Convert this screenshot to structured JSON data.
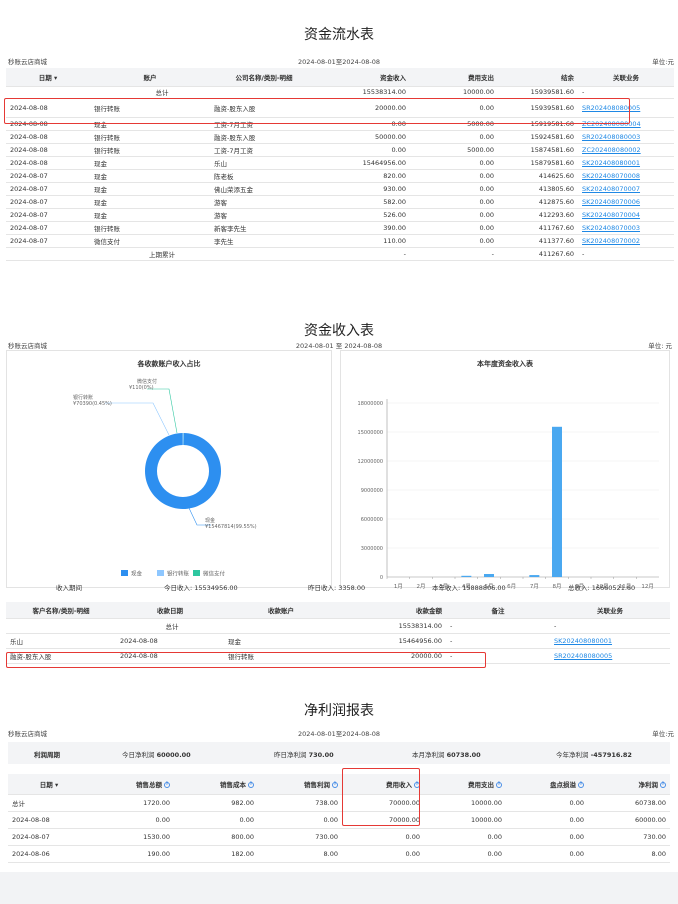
{
  "cash_flow": {
    "title": "资金流水表",
    "store": "秒账云店商城",
    "range": "2024-08-01至2024-08-08",
    "unit": "单位:元",
    "headers": [
      "日期 ▾",
      "账户",
      "公司名称/类别-明细",
      "资金收入",
      "费用支出",
      "结余",
      "关联业务"
    ],
    "total": {
      "label": "总计",
      "income": "15538314.00",
      "expense": "10000.00",
      "balance": "15939581.60",
      "biz": "-"
    },
    "rows": [
      [
        "2024-08-08",
        "银行转账",
        "融资-股东入股",
        "20000.00",
        "0.00",
        "15939581.60",
        "SR202408080005"
      ],
      [
        "2024-08-08",
        "现金",
        "工资-7月工资",
        "0.00",
        "5000.00",
        "15919581.60",
        "ZC202408080004"
      ],
      [
        "2024-08-08",
        "银行转账",
        "融资-股东入股",
        "50000.00",
        "0.00",
        "15924581.60",
        "SR202408080003"
      ],
      [
        "2024-08-08",
        "银行转账",
        "工资-7月工资",
        "0.00",
        "5000.00",
        "15874581.60",
        "ZC202408080002"
      ],
      [
        "2024-08-08",
        "现金",
        "乐山",
        "15464956.00",
        "0.00",
        "15879581.60",
        "SK202408080001"
      ],
      [
        "2024-08-07",
        "现金",
        "陈老板",
        "820.00",
        "0.00",
        "414625.60",
        "SK202408070008"
      ],
      [
        "2024-08-07",
        "现金",
        "佛山荣添五金",
        "930.00",
        "0.00",
        "413805.60",
        "SK202408070007"
      ],
      [
        "2024-08-07",
        "现金",
        "游客",
        "582.00",
        "0.00",
        "412875.60",
        "SK202408070006"
      ],
      [
        "2024-08-07",
        "现金",
        "游客",
        "526.00",
        "0.00",
        "412293.60",
        "SK202408070004"
      ],
      [
        "2024-08-07",
        "银行转账",
        "新客李先生",
        "390.00",
        "0.00",
        "411767.60",
        "SK202408070003"
      ],
      [
        "2024-08-07",
        "微信支付",
        "李先生",
        "110.00",
        "0.00",
        "411377.60",
        "SK202408070002"
      ]
    ],
    "prev": {
      "label": "上期累计",
      "income": "-",
      "expense": "-",
      "balance": "411267.60",
      "biz": "-"
    }
  },
  "income": {
    "title": "资金收入表",
    "store": "秒账云店商城",
    "range": "2024-08-01 至 2024-08-08",
    "unit": "单位: 元",
    "pie_title": "各收款账户收入占比",
    "bar_title": "本年度资金收入表",
    "summary": {
      "label": "收入期间",
      "today": "今日收入: 15534956.00",
      "yesterday": "昨日收入: 3358.00",
      "year": "本年收入: 15888806.00",
      "total": "总收入: 16660521.60"
    },
    "headers": [
      "客户名称/类别-明细",
      "收款日期",
      "收款账户",
      "收款金额",
      "备注",
      "关联业务"
    ],
    "total": {
      "label": "总计",
      "amount": "15538314.00",
      "note": "-",
      "biz": "-"
    },
    "rows": [
      [
        "乐山",
        "2024-08-08",
        "现金",
        "15464956.00",
        "-",
        "SK202408080001"
      ],
      [
        "融资-股东入股",
        "2024-08-08",
        "银行转账",
        "20000.00",
        "-",
        "SR202408080005"
      ]
    ]
  },
  "profit": {
    "title": "净利润报表",
    "store": "秒账云店商城",
    "range": "2024-08-01至2024-08-08",
    "unit": "单位:元",
    "band": {
      "label": "利润周期",
      "today_label": "今日净利润",
      "today": "60000.00",
      "yesterday_label": "昨日净利润",
      "yesterday": "730.00",
      "month_label": "本月净利润",
      "month": "60738.00",
      "year_label": "今年净利润",
      "year": "-457916.82"
    },
    "headers": [
      "日期 ▾",
      "销售总额",
      "销售成本",
      "销售利润",
      "费用收入",
      "费用支出",
      "盘点损溢",
      "净利润"
    ],
    "rows": [
      [
        "总计",
        "1720.00",
        "982.00",
        "738.00",
        "70000.00",
        "10000.00",
        "0.00",
        "60738.00"
      ],
      [
        "2024-08-08",
        "0.00",
        "0.00",
        "0.00",
        "70000.00",
        "10000.00",
        "0.00",
        "60000.00"
      ],
      [
        "2024-08-07",
        "1530.00",
        "800.00",
        "730.00",
        "0.00",
        "0.00",
        "0.00",
        "730.00"
      ],
      [
        "2024-08-06",
        "190.00",
        "182.00",
        "8.00",
        "0.00",
        "0.00",
        "0.00",
        "8.00"
      ]
    ]
  },
  "chart_data": [
    {
      "type": "pie",
      "title": "各收款账户收入占比",
      "labels": [
        "现金",
        "银行转账",
        "微信支付"
      ],
      "values": [
        15467814,
        70390,
        110
      ],
      "annotations": [
        "现金 ¥15467814(99.55%)",
        "银行转账 ¥70390(0.45%)",
        "微信支付 ¥110(0%)"
      ],
      "colors": [
        "#2d8ff0",
        "#8ec7ff",
        "#2ec7a0"
      ],
      "legend": "bottom"
    },
    {
      "type": "bar",
      "title": "本年度资金收入表",
      "categories": [
        "1月",
        "2月",
        "3月",
        "4月",
        "5月",
        "6月",
        "7月",
        "8月",
        "9月",
        "10月",
        "11月",
        "12月"
      ],
      "values": [
        0,
        0,
        0,
        30000,
        310000,
        0,
        200000,
        15538314,
        0,
        0,
        0,
        0
      ],
      "yticks": [
        "0",
        "3000000",
        "6000000",
        "9000000",
        "12000000",
        "15000000",
        "18000000"
      ],
      "ylim": [
        0,
        18000000
      ],
      "color": "#4aa8f0"
    }
  ]
}
